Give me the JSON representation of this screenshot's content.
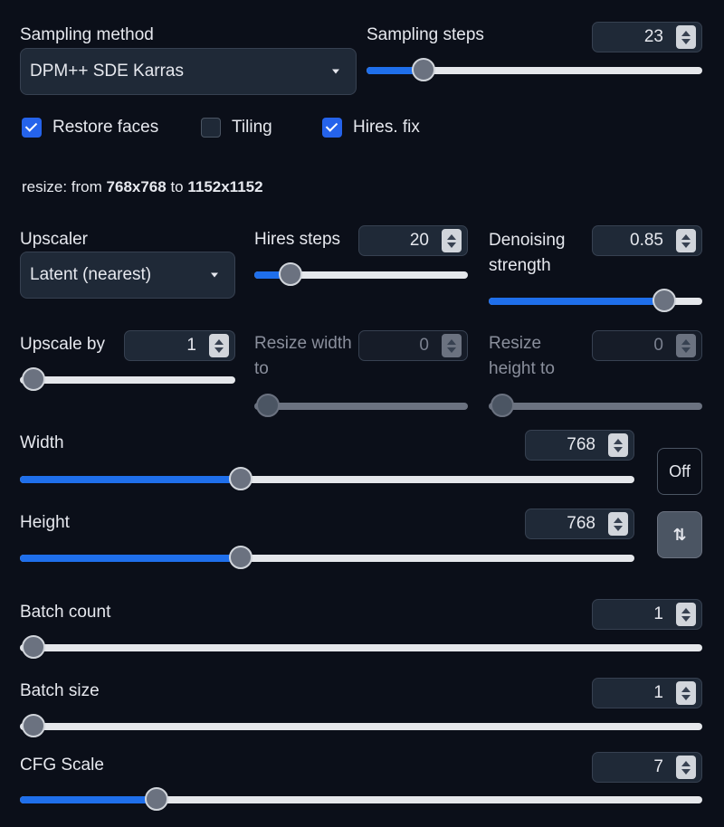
{
  "sampling": {
    "method_label": "Sampling method",
    "method_value": "DPM++ SDE Karras",
    "steps_label": "Sampling steps",
    "steps_value": "23"
  },
  "options": {
    "restore_faces": "Restore faces",
    "tiling": "Tiling",
    "hires_fix": "Hires. fix"
  },
  "resize_info": {
    "prefix": "resize: from ",
    "from": "768x768",
    "middle": " to ",
    "to": "1152x1152"
  },
  "hires": {
    "upscaler_label": "Upscaler",
    "upscaler_value": "Latent (nearest)",
    "steps_label": "Hires steps",
    "steps_value": "20",
    "denoise_label": "Denoising strength",
    "denoise_value": "0.85",
    "upscale_by_label": "Upscale by",
    "upscale_by_value": "1",
    "resize_width_label": "Resize width to",
    "resize_width_value": "0",
    "resize_height_label": "Resize height to",
    "resize_height_value": "0"
  },
  "size": {
    "width_label": "Width",
    "width_value": "768",
    "height_label": "Height",
    "height_value": "768",
    "off_button": "Off",
    "swap_icon": "⇅"
  },
  "batch": {
    "count_label": "Batch count",
    "count_value": "1",
    "size_label": "Batch size",
    "size_value": "1"
  },
  "cfg": {
    "label": "CFG Scale",
    "value": "7"
  },
  "slider_fractions": {
    "sampling_steps": 0.17,
    "hires_steps": 0.17,
    "denoising": 0.82,
    "upscale_by": 0.0,
    "resize_width": 0.0,
    "resize_height": 0.0,
    "width": 0.36,
    "height": 0.36,
    "batch_count": 0.0,
    "batch_size": 0.0,
    "cfg_scale": 0.2
  },
  "colors": {
    "accent": "#1f6feb",
    "background": "#0b0f19",
    "panel": "#1f2937"
  },
  "icons": {
    "dropdown_caret": "chevron-down-icon",
    "spinner": "spinner-arrows-icon",
    "check": "checkmark-icon",
    "swap": "swap-vertical-icon"
  }
}
